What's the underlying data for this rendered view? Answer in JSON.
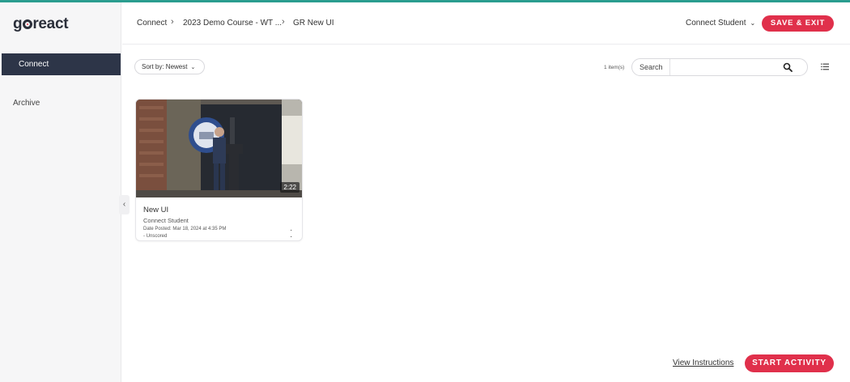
{
  "app": {
    "logo_text": "goreact"
  },
  "sidebar": {
    "items": [
      {
        "label": "Connect",
        "active": true
      },
      {
        "label": "Archive",
        "active": false
      }
    ],
    "collapse_icon": "chevron-left-icon"
  },
  "breadcrumb": [
    {
      "label": "Connect"
    },
    {
      "label": "2023 Demo Course - WT ..."
    },
    {
      "label": "GR New UI"
    }
  ],
  "header": {
    "user_menu_label": "Connect Student",
    "save_exit_label": "SAVE & EXIT"
  },
  "toolbar": {
    "sort_label": "Sort by: Newest",
    "item_count": "1 item(s)",
    "search_label": "Search",
    "search_value": ""
  },
  "videos": [
    {
      "title": "New UI",
      "author": "Connect Student",
      "date_posted": "Date Posted: Mar 18, 2024 at 4:35 PM",
      "score": "- Unscored",
      "duration": "2:22"
    }
  ],
  "footer": {
    "view_instructions_label": "View Instructions",
    "start_activity_label": "START ACTIVITY"
  },
  "colors": {
    "accent_red": "#e0304b",
    "nav_active_bg": "#2d3548",
    "top_line": "#2a9d8f"
  }
}
